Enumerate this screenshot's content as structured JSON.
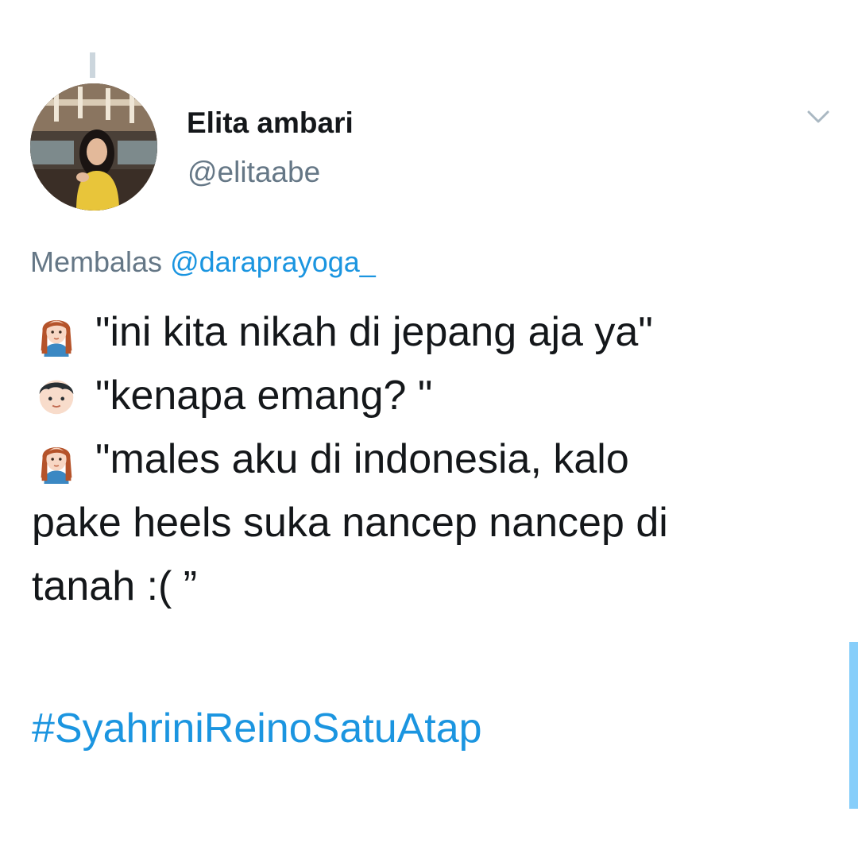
{
  "tweet": {
    "author": {
      "display_name": "Elita ambari",
      "handle": "@elitaabe"
    },
    "reply_to": {
      "prefix": "Membalas",
      "mention": "@daraprayoga_"
    },
    "lines": [
      {
        "emoji": "woman-emoji",
        "text": "\"ini kita nikah di jepang aja ya\""
      },
      {
        "emoji": "boy-emoji",
        "text": "\"kenapa emang? \""
      },
      {
        "emoji": "woman-emoji",
        "text": "\"males aku di indonesia, kalo"
      },
      {
        "emoji": null,
        "text": "pake heels suka nancep nancep di"
      },
      {
        "emoji": null,
        "text": "tanah :( ”"
      }
    ],
    "hashtag": "#SyahriniReinoSatuAtap"
  },
  "colors": {
    "link": "#1b95e0",
    "secondary_text": "#657786",
    "primary_text": "#14171a",
    "scroll_indicator": "#87cefa"
  }
}
